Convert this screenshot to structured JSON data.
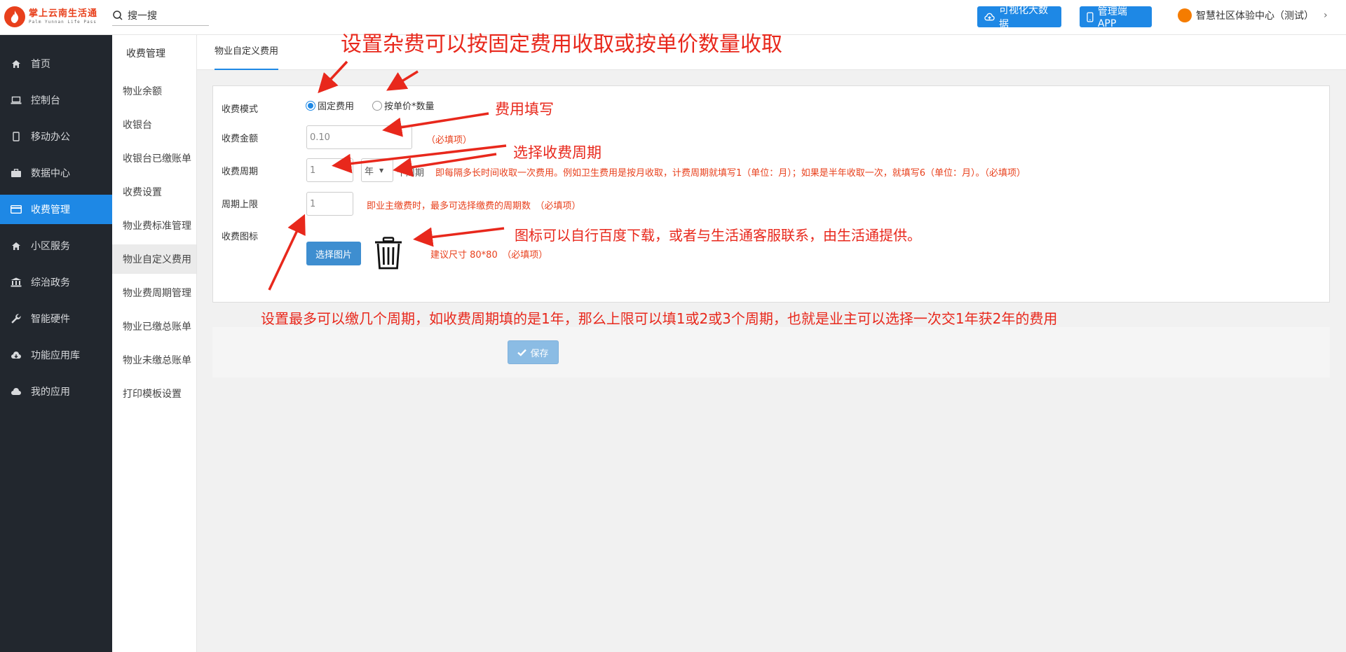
{
  "header": {
    "logo_cn": "掌上云南生活通",
    "logo_en": "Palm Yunnan Life Pass",
    "search_placeholder": "搜一搜",
    "btn_bigdata": "可视化大数据",
    "btn_app": "管理端APP",
    "user_name": "智慧社区体验中心（测试）"
  },
  "sidebar": {
    "items": [
      {
        "label": "首页",
        "icon": "home-icon"
      },
      {
        "label": "控制台",
        "icon": "laptop-icon"
      },
      {
        "label": "移动办公",
        "icon": "mobile-icon"
      },
      {
        "label": "数据中心",
        "icon": "briefcase-icon"
      },
      {
        "label": "收费管理",
        "icon": "credit-card-icon"
      },
      {
        "label": "小区服务",
        "icon": "home-icon"
      },
      {
        "label": "综治政务",
        "icon": "bank-icon"
      },
      {
        "label": "智能硬件",
        "icon": "wrench-icon"
      },
      {
        "label": "功能应用库",
        "icon": "cloud-download-icon"
      },
      {
        "label": "我的应用",
        "icon": "cloud-icon"
      }
    ],
    "active_index": 4
  },
  "subnav": {
    "title": "收费管理",
    "items": [
      "物业余额",
      "收银台",
      "收银台已缴账单",
      "收费设置",
      "物业费标准管理",
      "物业自定义费用",
      "物业费周期管理",
      "物业已缴总账单",
      "物业未缴总账单",
      "打印模板设置"
    ],
    "active_index": 5
  },
  "tab": {
    "label": "物业自定义费用"
  },
  "form": {
    "mode_label": "收费模式",
    "mode_options": [
      "固定费用",
      "按单价*数量"
    ],
    "mode_selected": 0,
    "amount_label": "收费金额",
    "amount_value": "0.10",
    "amount_hint": "（必填项）",
    "period_label": "收费周期",
    "period_value": "1",
    "period_unit": "年",
    "period_suffix": "个周期",
    "period_hint": "即每隔多长时间收取一次费用。例如卫生费用是按月收取，计费周期就填写1（单位：月）；如果是半年收取一次，就填写6（单位：月）。（必填项）",
    "limit_label": "周期上限",
    "limit_value": "1",
    "limit_hint": "即业主缴费时，最多可选择缴费的周期数　（必填项）",
    "icon_label": "收费图标",
    "select_image_btn": "选择图片",
    "icon_hint": "建议尺寸 80*80　（必填项）",
    "save_btn": "保存"
  },
  "annotations": {
    "a1": "设置杂费可以按固定费用收取或按单价数量收取",
    "a2": "费用填写",
    "a3": "选择收费周期",
    "a4": "图标可以自行百度下载，或者与生活通客服联系，由生活通提供。",
    "a5": "设置最多可以缴几个周期，如收费周期填的是1年，那么上限可以填1或2或3个周期，也就是业主可以选择一次交1年获2年的费用"
  },
  "colors": {
    "accent": "#1e88e5",
    "sidebar_bg": "#22272e",
    "annotation": "#e8281c",
    "hint": "#e8401c"
  }
}
